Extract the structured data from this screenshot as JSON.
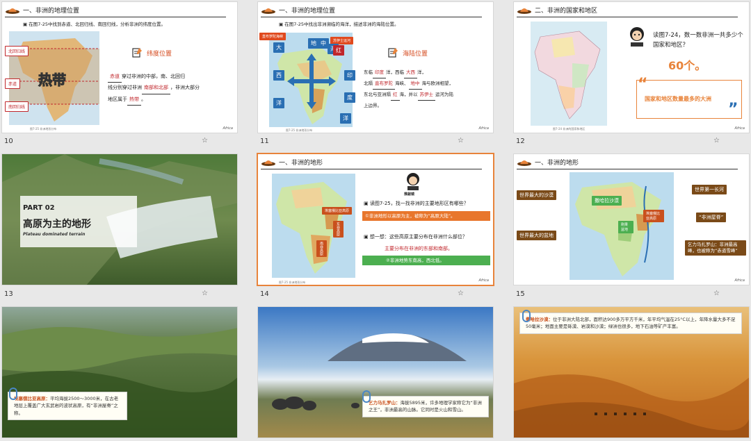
{
  "slides": {
    "s10": {
      "num": "10",
      "title": "一、非洲的地理位置",
      "task": "在图7-25中找到赤道、北回归线、南回归线，分析非洲的纬度位置。",
      "lines": {
        "north": "北回归线",
        "equator": "赤道",
        "south": "南回归线"
      },
      "zone": "热带",
      "section": "纬度位置",
      "text_a": "穿过非洲的中部，南、北回归",
      "text_b": "线分别穿过非洲",
      "text_c": "，非洲大部分",
      "text_d": "地区属于",
      "blank1": "赤道",
      "blank2": "南部和北部",
      "blank3": "热带",
      "caption": "图7-25 非洲地形分布",
      "africa": "Africa"
    },
    "s11": {
      "num": "11",
      "title": "一、非洲的地理位置",
      "task": "在图7-25中找出非洲濒临的海洋，描述非洲的海陆位置。",
      "tag_left": "直布罗陀海峡",
      "tag_right": "苏伊士运河",
      "chars": {
        "da": "大",
        "xi": "西",
        "yang1": "洋",
        "di": "地",
        "zhong": "中",
        "hai": "海",
        "hong": "红",
        "yin": "印",
        "du": "度",
        "yang2": "洋"
      },
      "section": "海陆位置",
      "l1a": "东临",
      "l1b": "洋，西临",
      "l1c": "洋，",
      "b1": "印度",
      "b2": "大西",
      "l2a": "北隔",
      "l2b": "海峡、",
      "l2c": "海与欧洲相望，",
      "b3": "直布罗陀",
      "b4": "地中",
      "l3a": "东北与亚洲隔",
      "l3b": "海，并以",
      "l3c": "运河为陆",
      "b5": "红",
      "b6": "苏伊士",
      "l4": "上边界。",
      "caption": "图7-25 非洲地形分布",
      "africa": "Africa"
    },
    "s12": {
      "num": "12",
      "title": "二、非洲的国家和地区",
      "question": "读图7-24，数一数非洲一共多少个国家和地区？",
      "answer": "60个。",
      "quote": "国家和地区数量最多的大洲",
      "caption": "图7-24 非洲的国家和地区",
      "africa": "Africa"
    },
    "s13": {
      "num": "13",
      "part": "PART 02",
      "title": "高原为主的地形",
      "subtitle": "Plateau dominated terrain"
    },
    "s14": {
      "num": "14",
      "title": "一、非洲的地形",
      "badge": "推敲镜",
      "q1": "读图7-25，找一找非洲的主要地形区有哪些？",
      "a1": "①非洲地形以高原为主，被称为“高原大陆”。",
      "q2": "想一想：这些高原主要分布在非洲什么部位？",
      "a2": "主要分布在非洲的东部和南部。",
      "a3": "②非洲地势东南高，西北低。",
      "tag_ethiopia": "埃塞俄比亚高原",
      "tag_east": "东非高原",
      "tag_south": "南非高原",
      "caption": "图7-25 非洲地形分布",
      "africa": "Africa"
    },
    "s15": {
      "num": "15",
      "title": "一、非洲的地形",
      "l1": "世界最大的沙漠",
      "l2": "世界最大的盆地",
      "sahara": "撒哈拉沙漠",
      "ethiopia": "埃塞俄比亚高原",
      "congo": "刚果盆地",
      "r1": "世界第一长河",
      "r2": "“非洲屋脊”",
      "r3": "乞力马扎罗山：非洲最高峰，也被称为“赤道雪峰”",
      "africa": "Africa"
    },
    "s16": {
      "title": "埃塞俄比亚高原：",
      "body": "平均海拔2500～3000米，在古老地层上覆盖广大玄武岩的波状高原，有“非洲屋脊”之称。"
    },
    "s17": {
      "title": "乞力马扎罗山：",
      "body": "海拔5895米，许多地理学家称它为“非洲之王”，非洲最高的山脉。它同时是火山和雪山。"
    },
    "s18": {
      "title": "撒哈拉沙漠：",
      "body": "位于非洲大陆北部，面积达900多万平方千米，年平均气温在25°C以上，年降水量大多不足50毫米；地面主要是砾漠、岩漠和沙漠；绿洲也很多，地下石油等矿产丰富。"
    },
    "colors": {
      "accent": "#e8833a",
      "red": "#c0262b",
      "brown": "#7a4a18",
      "orange_btn": "#e8762c",
      "green_btn": "#4caf50"
    }
  }
}
